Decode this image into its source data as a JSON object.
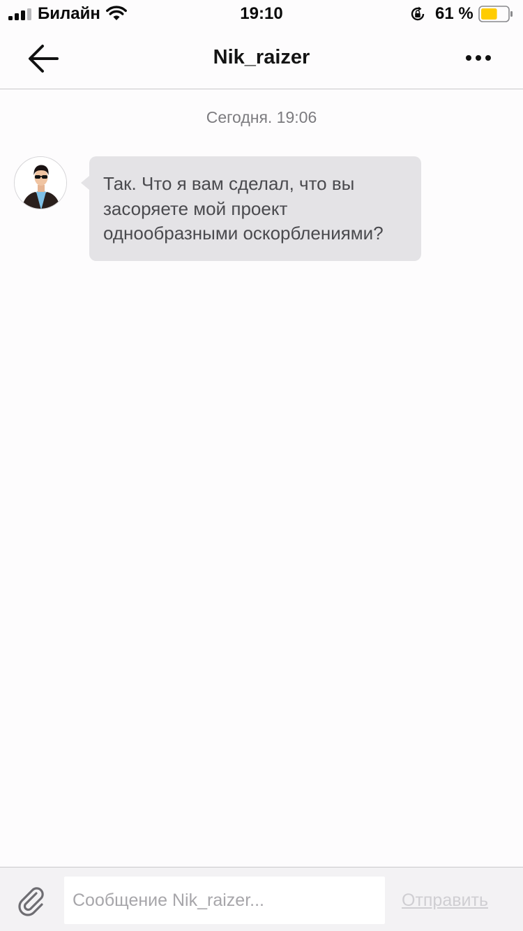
{
  "status_bar": {
    "carrier": "Билайн",
    "time": "19:10",
    "battery_percent": "61 %",
    "battery_level": 0.61,
    "signal_bars": 3,
    "battery_color": "#ffcc00",
    "icons": [
      "signal-icon",
      "wifi-icon",
      "rotation-lock-icon",
      "battery-icon"
    ]
  },
  "header": {
    "title": "Nik_raizer",
    "back_icon": "arrow-left-icon",
    "more_icon": "more-dots-icon"
  },
  "chat": {
    "date_separator": "Сегодня. 19:06",
    "messages": [
      {
        "sender_avatar": "avatar-man-sunglasses",
        "text": "Так. Что я вам сделал, что вы\nзасоряете мой проект\nоднообразными оскорблениями?"
      }
    ]
  },
  "composer": {
    "attach_icon": "paperclip-icon",
    "input_value": "",
    "input_placeholder": "Сообщение Nik_raizer...",
    "send_label": "Отправить"
  }
}
